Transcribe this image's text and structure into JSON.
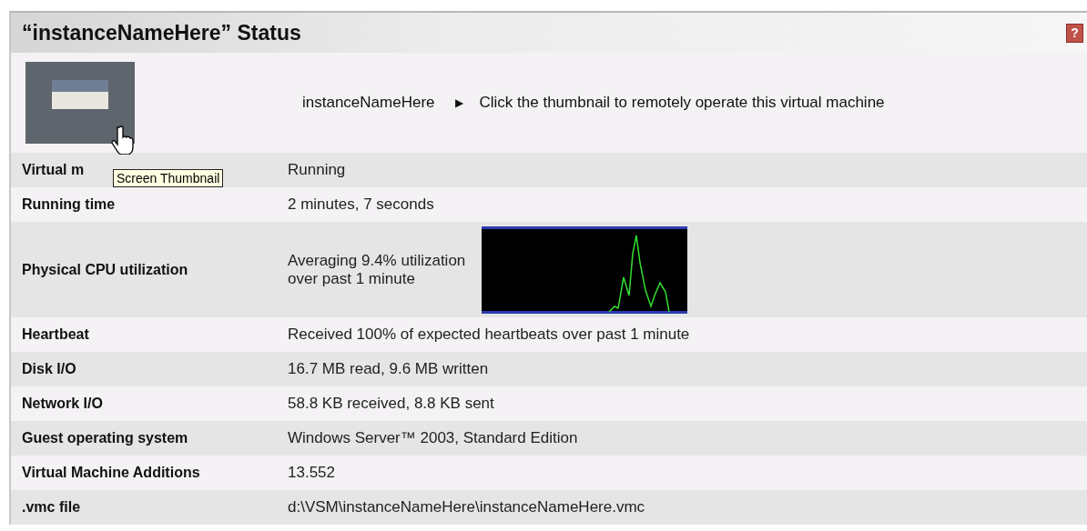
{
  "panel": {
    "title": "“instanceNameHere” Status",
    "help_icon": "?"
  },
  "thumbnail_row": {
    "name": "instanceNameHere",
    "arrow": "▶",
    "hint": "Click the thumbnail to remotely operate this virtual machine",
    "tooltip": "Screen Thumbnail"
  },
  "rows": [
    {
      "kind": "text",
      "label": "Virtual m",
      "value": "Running"
    },
    {
      "kind": "text",
      "label": "Running time",
      "value": "2 minutes, 7 seconds"
    },
    {
      "kind": "cpu",
      "label": "Physical CPU utilization",
      "value": "Averaging 9.4% utilization\nover past 1 minute"
    },
    {
      "kind": "text",
      "label": "Heartbeat",
      "value": "Received 100% of expected heartbeats over past 1 minute"
    },
    {
      "kind": "text",
      "label": "Disk I/O",
      "value": "16.7 MB read, 9.6 MB written"
    },
    {
      "kind": "text",
      "label": "Network I/O",
      "value": "58.8 KB received, 8.8 KB sent"
    },
    {
      "kind": "text",
      "label": "Guest operating system",
      "value": "Windows Server™ 2003, Standard Edition"
    },
    {
      "kind": "text",
      "label": "Virtual Machine Additions",
      "value": "13.552"
    },
    {
      "kind": "text",
      "label": ".vmc file",
      "value": "d:\\VSM\\instanceNameHere\\instanceNameHere.vmc"
    }
  ]
}
